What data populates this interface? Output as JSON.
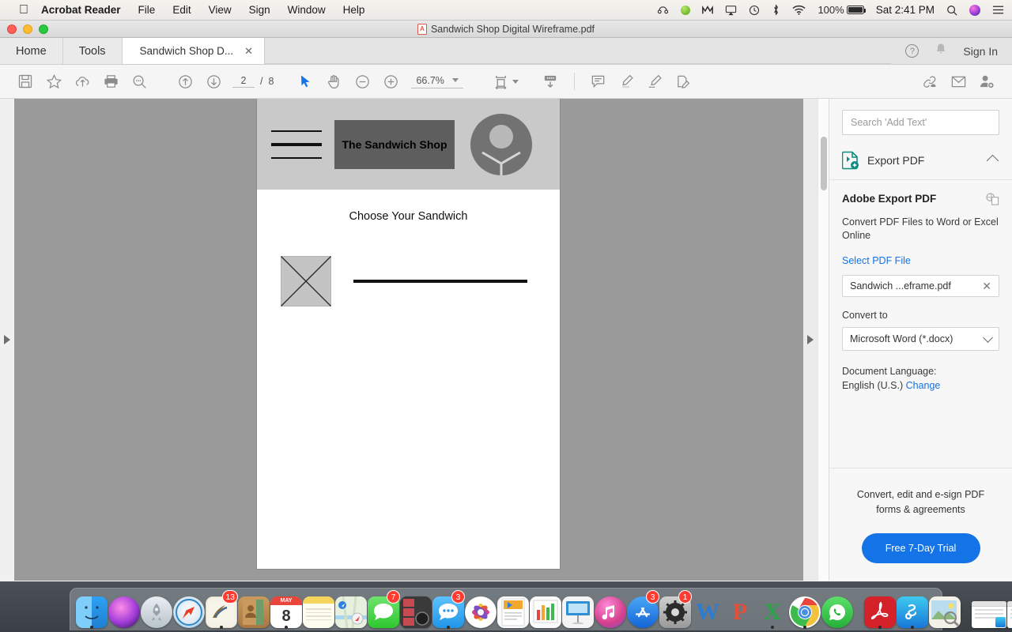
{
  "menubar": {
    "apple": "",
    "items": [
      {
        "label": "Acrobat Reader",
        "bold": true
      },
      {
        "label": "File"
      },
      {
        "label": "Edit"
      },
      {
        "label": "View"
      },
      {
        "label": "Sign"
      },
      {
        "label": "Window"
      },
      {
        "label": "Help"
      }
    ],
    "status": {
      "battery_percent": "100%",
      "clock": "Sat 2:41 PM",
      "icons": [
        "headphones-icon",
        "green-dot-icon",
        "malwarebytes-icon",
        "airplay-icon",
        "time-machine-icon",
        "bluetooth-icon",
        "wifi-icon",
        "battery-icon",
        "spotlight-search-icon",
        "siri-icon",
        "notification-center-icon"
      ]
    }
  },
  "window": {
    "title": "Sandwich Shop Digital Wireframe.pdf",
    "nav": {
      "home": "Home",
      "tools": "Tools"
    },
    "tab": {
      "label": "Sandwich Shop D...",
      "close": "✕"
    },
    "right": {
      "help": "?",
      "bell_icon": "bell-icon",
      "sign_in": "Sign In"
    }
  },
  "toolbar": {
    "icons": [
      "save-icon",
      "star-icon",
      "upload-cloud-icon",
      "print-icon",
      "search-icon",
      "previous-page-icon",
      "next-page-icon",
      "select-tool-icon",
      "hand-tool-icon",
      "zoom-out-icon",
      "zoom-in-icon",
      "fit-page-icon",
      "scroll-mode-icon",
      "comment-icon",
      "highlight-icon",
      "sign-icon",
      "fill-and-sign-icon",
      "share-link-icon",
      "email-icon",
      "add-person-icon"
    ],
    "page_current": "2",
    "page_sep": "/",
    "page_total": "8",
    "zoom_level": "66.7%"
  },
  "document": {
    "wireframe": {
      "logo_text": "The Sandwich Shop",
      "heading": "Choose Your Sandwich",
      "hamburger_icon": "hamburger-menu-icon",
      "avatar_icon": "user-avatar-icon",
      "image_placeholder_icon": "image-placeholder-icon"
    }
  },
  "panel": {
    "search_placeholder": "Search 'Add Text'",
    "search_value": "",
    "export_header": "Export PDF",
    "export_icon": "export-pdf-icon",
    "collapse_icon": "chevron-up-icon",
    "title": "Adobe Export PDF",
    "copy_icon": "copy-files-icon",
    "subtitle": "Convert PDF Files to Word or Excel Online",
    "select_file_link": "Select PDF File",
    "file_name": "Sandwich ...eframe.pdf",
    "file_clear": "✕",
    "convert_to_label": "Convert to",
    "convert_to_value": "Microsoft Word (*.docx)",
    "convert_to_options": [
      "Microsoft Word (*.docx)"
    ],
    "document_language_label": "Document Language:",
    "document_language_value": "English (U.S.)",
    "change_link": "Change",
    "promo_text": "Convert, edit and e-sign PDF forms & agreements",
    "trial_button": "Free 7-Day Trial"
  },
  "colors": {
    "accent_blue": "#1473e6",
    "badge_red": "#ff3b30",
    "doc_bg": "#9a9a9a",
    "wireframe_header": "#c9c9c9",
    "logo_box": "#5e5e5e"
  },
  "dock": {
    "items": [
      {
        "name": "finder",
        "badge": null,
        "running": true
      },
      {
        "name": "siri",
        "badge": null,
        "running": false
      },
      {
        "name": "launchpad",
        "badge": null,
        "running": false
      },
      {
        "name": "safari",
        "badge": null,
        "running": false
      },
      {
        "name": "mail",
        "badge": "13",
        "running": true
      },
      {
        "name": "contacts",
        "badge": null,
        "running": false
      },
      {
        "name": "calendar",
        "badge": null,
        "running": true,
        "month": "MAY",
        "day": "8"
      },
      {
        "name": "notes",
        "badge": null,
        "running": false
      },
      {
        "name": "maps",
        "badge": null,
        "running": false
      },
      {
        "name": "messages",
        "badge": "7",
        "running": false
      },
      {
        "name": "photo-booth",
        "badge": null,
        "running": false
      },
      {
        "name": "messages-alt",
        "badge": "3",
        "running": true
      },
      {
        "name": "photos",
        "badge": null,
        "running": false
      },
      {
        "name": "pages",
        "badge": null,
        "running": false
      },
      {
        "name": "numbers",
        "badge": null,
        "running": false
      },
      {
        "name": "keynote",
        "badge": null,
        "running": false
      },
      {
        "name": "itunes",
        "badge": null,
        "running": false
      },
      {
        "name": "app-store",
        "badge": "3",
        "running": false
      },
      {
        "name": "system-preferences",
        "badge": "1",
        "running": false
      },
      {
        "name": "microsoft-word",
        "badge": null,
        "running": false
      },
      {
        "name": "microsoft-powerpoint",
        "badge": null,
        "running": false
      },
      {
        "name": "microsoft-excel",
        "badge": null,
        "running": true
      },
      {
        "name": "google-chrome",
        "badge": null,
        "running": true
      },
      {
        "name": "whatsapp",
        "badge": null,
        "running": false
      },
      {
        "name": "adobe-acrobat",
        "badge": null,
        "running": true
      },
      {
        "name": "skitch",
        "badge": null,
        "running": true
      },
      {
        "name": "preview",
        "badge": null,
        "running": false
      }
    ],
    "trash": "trash-icon"
  }
}
